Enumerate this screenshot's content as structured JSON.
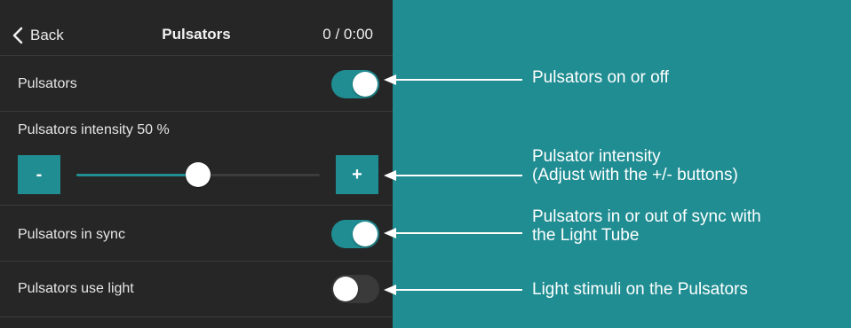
{
  "navbar": {
    "back_label": "Back",
    "title": "Pulsators",
    "status": "0 / 0:00"
  },
  "rows": {
    "pulsators": {
      "label": "Pulsators",
      "enabled": true
    },
    "intensity": {
      "label": "Pulsators intensity 50 %",
      "value_percent": 50,
      "minus_label": "-",
      "plus_label": "+"
    },
    "sync": {
      "label": "Pulsators in sync",
      "enabled": true
    },
    "use_light": {
      "label": "Pulsators use light",
      "enabled": false
    }
  },
  "callouts": {
    "onoff": "Pulsators on or off",
    "intensity_line1": "Pulsator intensity",
    "intensity_line2": "(Adjust with the +/- buttons)",
    "sync_line1": "Pulsators in or out of sync with",
    "sync_line2": "the Light Tube",
    "light": "Light stimuli on the Pulsators"
  },
  "colors": {
    "accent": "#1f8d92",
    "panel_bg": "#262626",
    "divider": "#3b3b3b",
    "text": "#ededed"
  },
  "icons": {
    "back": "chevron-left-icon",
    "arrow": "arrow-left-icon"
  }
}
